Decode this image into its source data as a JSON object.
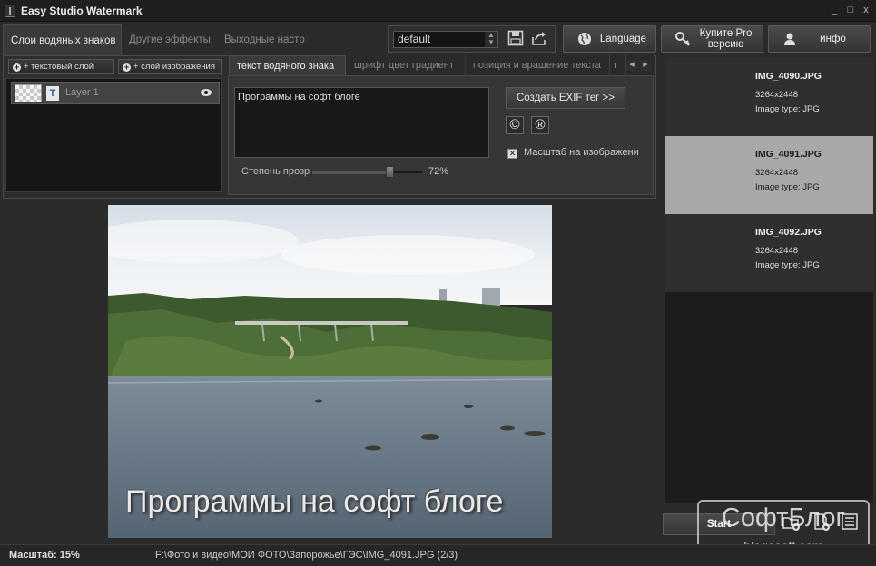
{
  "window": {
    "title": "Easy Studio Watermark",
    "controls": [
      "_",
      "□",
      "x"
    ]
  },
  "main_tabs": [
    {
      "label": "Слои водяных знаков",
      "active": true
    },
    {
      "label": "Другие эффекты",
      "active": false
    },
    {
      "label": "Выходные настр",
      "active": false
    }
  ],
  "preset": {
    "value": "default"
  },
  "toolbar": {
    "language_label": "Language",
    "buy_pro_label": "Купите Pro версию",
    "info_label": "инфо"
  },
  "layers": {
    "add_text_label": "+ текстовый слой",
    "add_image_label": "+ слой изображения",
    "items": [
      {
        "name": "Layer 1",
        "type_glyph": "T"
      }
    ]
  },
  "sub_tabs": [
    {
      "label": "текст водяного знака",
      "active": true
    },
    {
      "label": "шрифт цвет градиент",
      "active": false
    },
    {
      "label": "позиция и вращение текста",
      "active": false
    },
    {
      "label": "т",
      "active": false
    }
  ],
  "text_tab": {
    "watermark_text": "Программы на софт блоге",
    "exif_button": "Создать EXIF тег >>",
    "copyright_symbol": "©",
    "registered_symbol": "®",
    "scale_checkbox_label": "Масштаб на изображени",
    "scale_checked": true,
    "opacity_label": "Степень прозр",
    "opacity_percent": 72,
    "opacity_value_text": "72%"
  },
  "preview": {
    "watermark_overlay": "Программы на софт блоге"
  },
  "images": [
    {
      "filename": "IMG_4090.JPG",
      "dimensions": "3264x2448",
      "type": "Image type: JPG",
      "selected": false
    },
    {
      "filename": "IMG_4091.JPG",
      "dimensions": "3264x2448",
      "type": "Image type: JPG",
      "selected": true
    },
    {
      "filename": "IMG_4092.JPG",
      "dimensions": "3264x2448",
      "type": "Image type: JPG",
      "selected": false
    }
  ],
  "bottom": {
    "start_label": "Start",
    "icons": [
      "add-folder-icon",
      "add-file-icon",
      "list-icon"
    ]
  },
  "brand_watermark": {
    "line1": "СофтБлог",
    "line2": "– blogosoft.com –"
  },
  "status": {
    "zoom": "Масштаб: 15%",
    "path": "F:\\Фото и видео\\МОИ ФОТО\\Запорожье\\ГЭС\\IMG_4091.JPG (2/3)"
  },
  "colors": {
    "background": "#2b2b2b",
    "selected_thumb": "#a8a8a8",
    "panel": "#363636"
  }
}
